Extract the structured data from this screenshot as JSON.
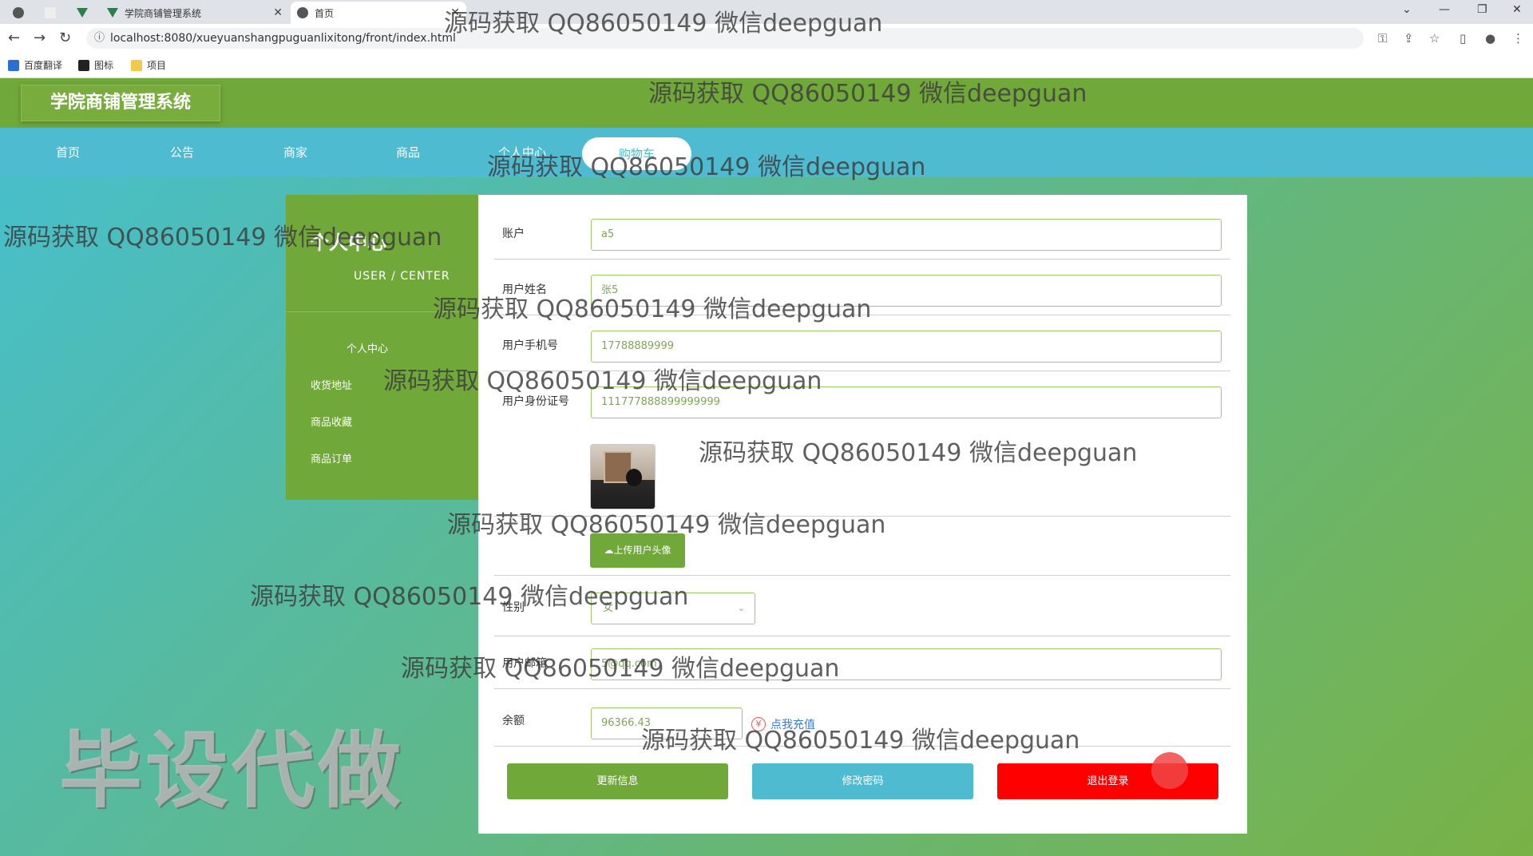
{
  "browser": {
    "tabs": [
      {
        "label": "学院商铺管理系统"
      },
      {
        "label": "首页"
      }
    ],
    "url": "localhost:8080/xueyuanshangpuguanlixitong/front/index.html",
    "bookmarks": [
      "百度翻译",
      "图标",
      "项目"
    ]
  },
  "header": {
    "logo": "学院商铺管理系统"
  },
  "menu": {
    "items": [
      "首页",
      "公告",
      "商家",
      "商品",
      "个人中心",
      "购物车"
    ]
  },
  "sidebar": {
    "title": "个人中心",
    "subtitle": "USER / CENTER",
    "items": [
      "个人中心",
      "收货地址",
      "商品收藏",
      "商品订单"
    ]
  },
  "form": {
    "account_label": "账户",
    "account_value": "a5",
    "name_label": "用户姓名",
    "name_value": "张5",
    "phone_label": "用户手机号",
    "phone_value": "17788889999",
    "id_label": "用户身份证号",
    "id_value": "111777888899999999",
    "upload_label": "上传用户头像",
    "gender_label": "性别",
    "gender_value": "女",
    "email_label": "用户邮箱",
    "email_value": "5@qq.com",
    "balance_label": "余额",
    "balance_value": "96366.43",
    "recharge_label": "点我充值",
    "recharge_icon": "yen-circle-icon"
  },
  "buttons": {
    "update": "更新信息",
    "password": "修改密码",
    "logout": "退出登录"
  },
  "colors": {
    "green": "#71a83a",
    "cyan": "#4fbbd0",
    "red": "#ff0000"
  },
  "watermarks": {
    "text": "源码获取 QQ86050149 微信deepguan",
    "stamp": "毕设代做"
  }
}
